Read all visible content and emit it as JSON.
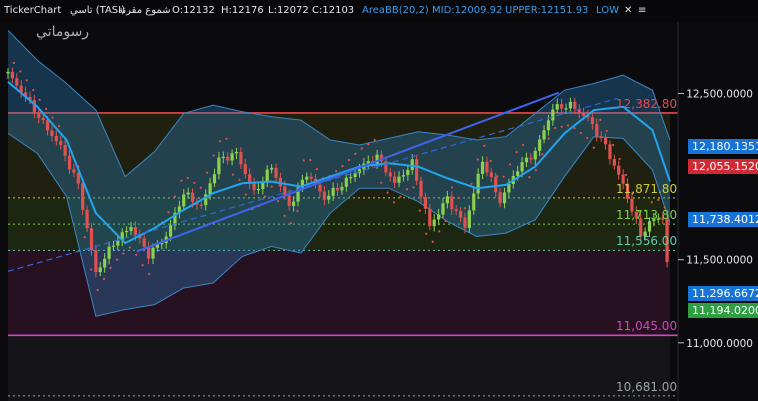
{
  "header": {
    "ticker_label": "TickerChart",
    "instrument": "تاسي (TASI)",
    "chart_kind": "شموع مقرنة",
    "open": "O:12132",
    "high": "H:12176",
    "low": "L:12072",
    "close": "C:12103",
    "indicator": "AreaBB(20,2)",
    "mid": "MID:12009.92",
    "upper": "UPPER:12151.93",
    "lower": "LOW",
    "close_glyph": "✕",
    "more_glyph": "≡"
  },
  "watermark": "رسوماتي",
  "colors": {
    "bull": "#8bd14f",
    "bear": "#e0514f",
    "band_fill": "#2f8ccf",
    "mid_line": "#23a4ef",
    "trend": "#3e63ee",
    "resistance": "#e7484b",
    "support_pink": "#d642c8",
    "price_blue": "#1873d6",
    "price_red": "#d12a35",
    "price_green": "#2ea043"
  },
  "levels": [
    {
      "label": "12,382.80",
      "value": 12382.8,
      "color": "#e7484b"
    },
    {
      "label": "11,871.80",
      "value": 11871.8,
      "color": "#c9cf3a"
    },
    {
      "label": "11,713.80",
      "value": 11713.8,
      "color": "#7bd04a"
    },
    {
      "label": "11,556.00",
      "value": 11556.0,
      "color": "#5fc8b0"
    },
    {
      "label": "11,045.00",
      "value": 11045.0,
      "color": "#d642c8"
    },
    {
      "label": "10,681.00",
      "value": 10681.0,
      "color": "#9aa0a8"
    }
  ],
  "price_tags": [
    {
      "label": "12,180.1351",
      "value": 12180.1351,
      "kind": "blue"
    },
    {
      "label": "12,055.1520",
      "value": 12055.152,
      "kind": "red"
    },
    {
      "label": "11,738.4012",
      "value": 11738.4012,
      "kind": "blue"
    },
    {
      "label": "11,296.6672",
      "value": 11296.6672,
      "kind": "blue"
    },
    {
      "label": "11,194.0200",
      "value": 11194.02,
      "kind": "green"
    }
  ],
  "chart_data": {
    "type": "line",
    "title": "",
    "xlabel": "",
    "ylabel": "",
    "ylim": [
      10650,
      12930
    ],
    "y_ticks": [
      "12,500.0000",
      "11,500.0000",
      "11,000.0000"
    ],
    "y_tick_values": [
      12500,
      11500,
      11000
    ],
    "series": [
      {
        "name": "AreaBB(20,2) MID",
        "x": [
          0,
          5,
          10,
          15,
          20,
          25,
          30,
          35,
          40,
          45,
          50,
          55,
          60,
          65,
          70,
          75,
          80,
          85,
          90,
          95,
          100,
          105,
          110,
          113
        ],
        "values": [
          12570,
          12420,
          12220,
          11780,
          11600,
          11690,
          11800,
          11900,
          11960,
          11970,
          11940,
          12000,
          12060,
          12080,
          12060,
          11990,
          11930,
          11950,
          12060,
          12260,
          12400,
          12420,
          12280,
          11970
        ]
      },
      {
        "name": "AreaBB(20,2) UPPER",
        "x": [
          0,
          5,
          10,
          15,
          20,
          25,
          30,
          35,
          40,
          45,
          50,
          55,
          60,
          65,
          70,
          75,
          80,
          85,
          90,
          95,
          100,
          105,
          110,
          113
        ],
        "values": [
          12880,
          12700,
          12560,
          12400,
          12000,
          12150,
          12380,
          12430,
          12390,
          12360,
          12340,
          12220,
          12190,
          12230,
          12270,
          12250,
          12220,
          12240,
          12380,
          12520,
          12560,
          12610,
          12520,
          12220
        ]
      },
      {
        "name": "AreaBB(20,2) LOW",
        "x": [
          0,
          5,
          10,
          15,
          20,
          25,
          30,
          35,
          40,
          45,
          50,
          55,
          60,
          65,
          70,
          75,
          80,
          85,
          90,
          95,
          100,
          105,
          110,
          113
        ],
        "values": [
          12260,
          12140,
          11880,
          11160,
          11200,
          11230,
          11330,
          11360,
          11520,
          11580,
          11540,
          11780,
          11930,
          11930,
          11850,
          11730,
          11640,
          11660,
          11740,
          12000,
          12240,
          12230,
          12040,
          11720
        ]
      },
      {
        "name": "Close",
        "x": [
          0,
          3,
          6,
          9,
          12,
          15,
          18,
          21,
          24,
          27,
          30,
          33,
          36,
          39,
          42,
          45,
          48,
          51,
          54,
          57,
          60,
          63,
          66,
          69,
          72,
          75,
          78,
          81,
          84,
          87,
          90,
          93,
          96,
          99,
          102,
          105,
          108,
          110,
          112,
          113
        ],
        "values": [
          12620,
          12480,
          12320,
          12180,
          11950,
          11420,
          11600,
          11700,
          11530,
          11640,
          11900,
          11820,
          12100,
          12140,
          11900,
          12060,
          11820,
          12020,
          11870,
          11950,
          12050,
          12120,
          11960,
          12080,
          11700,
          11870,
          11700,
          12100,
          11850,
          12050,
          12150,
          12410,
          12430,
          12350,
          12180,
          11950,
          11650,
          11740,
          11760,
          11194
        ]
      }
    ],
    "trendlines": [
      {
        "x": [
          0,
          104
        ],
        "values": [
          11430,
          12470
        ]
      },
      {
        "x": [
          22,
          94
        ],
        "values": [
          11550,
          12505
        ]
      }
    ]
  }
}
